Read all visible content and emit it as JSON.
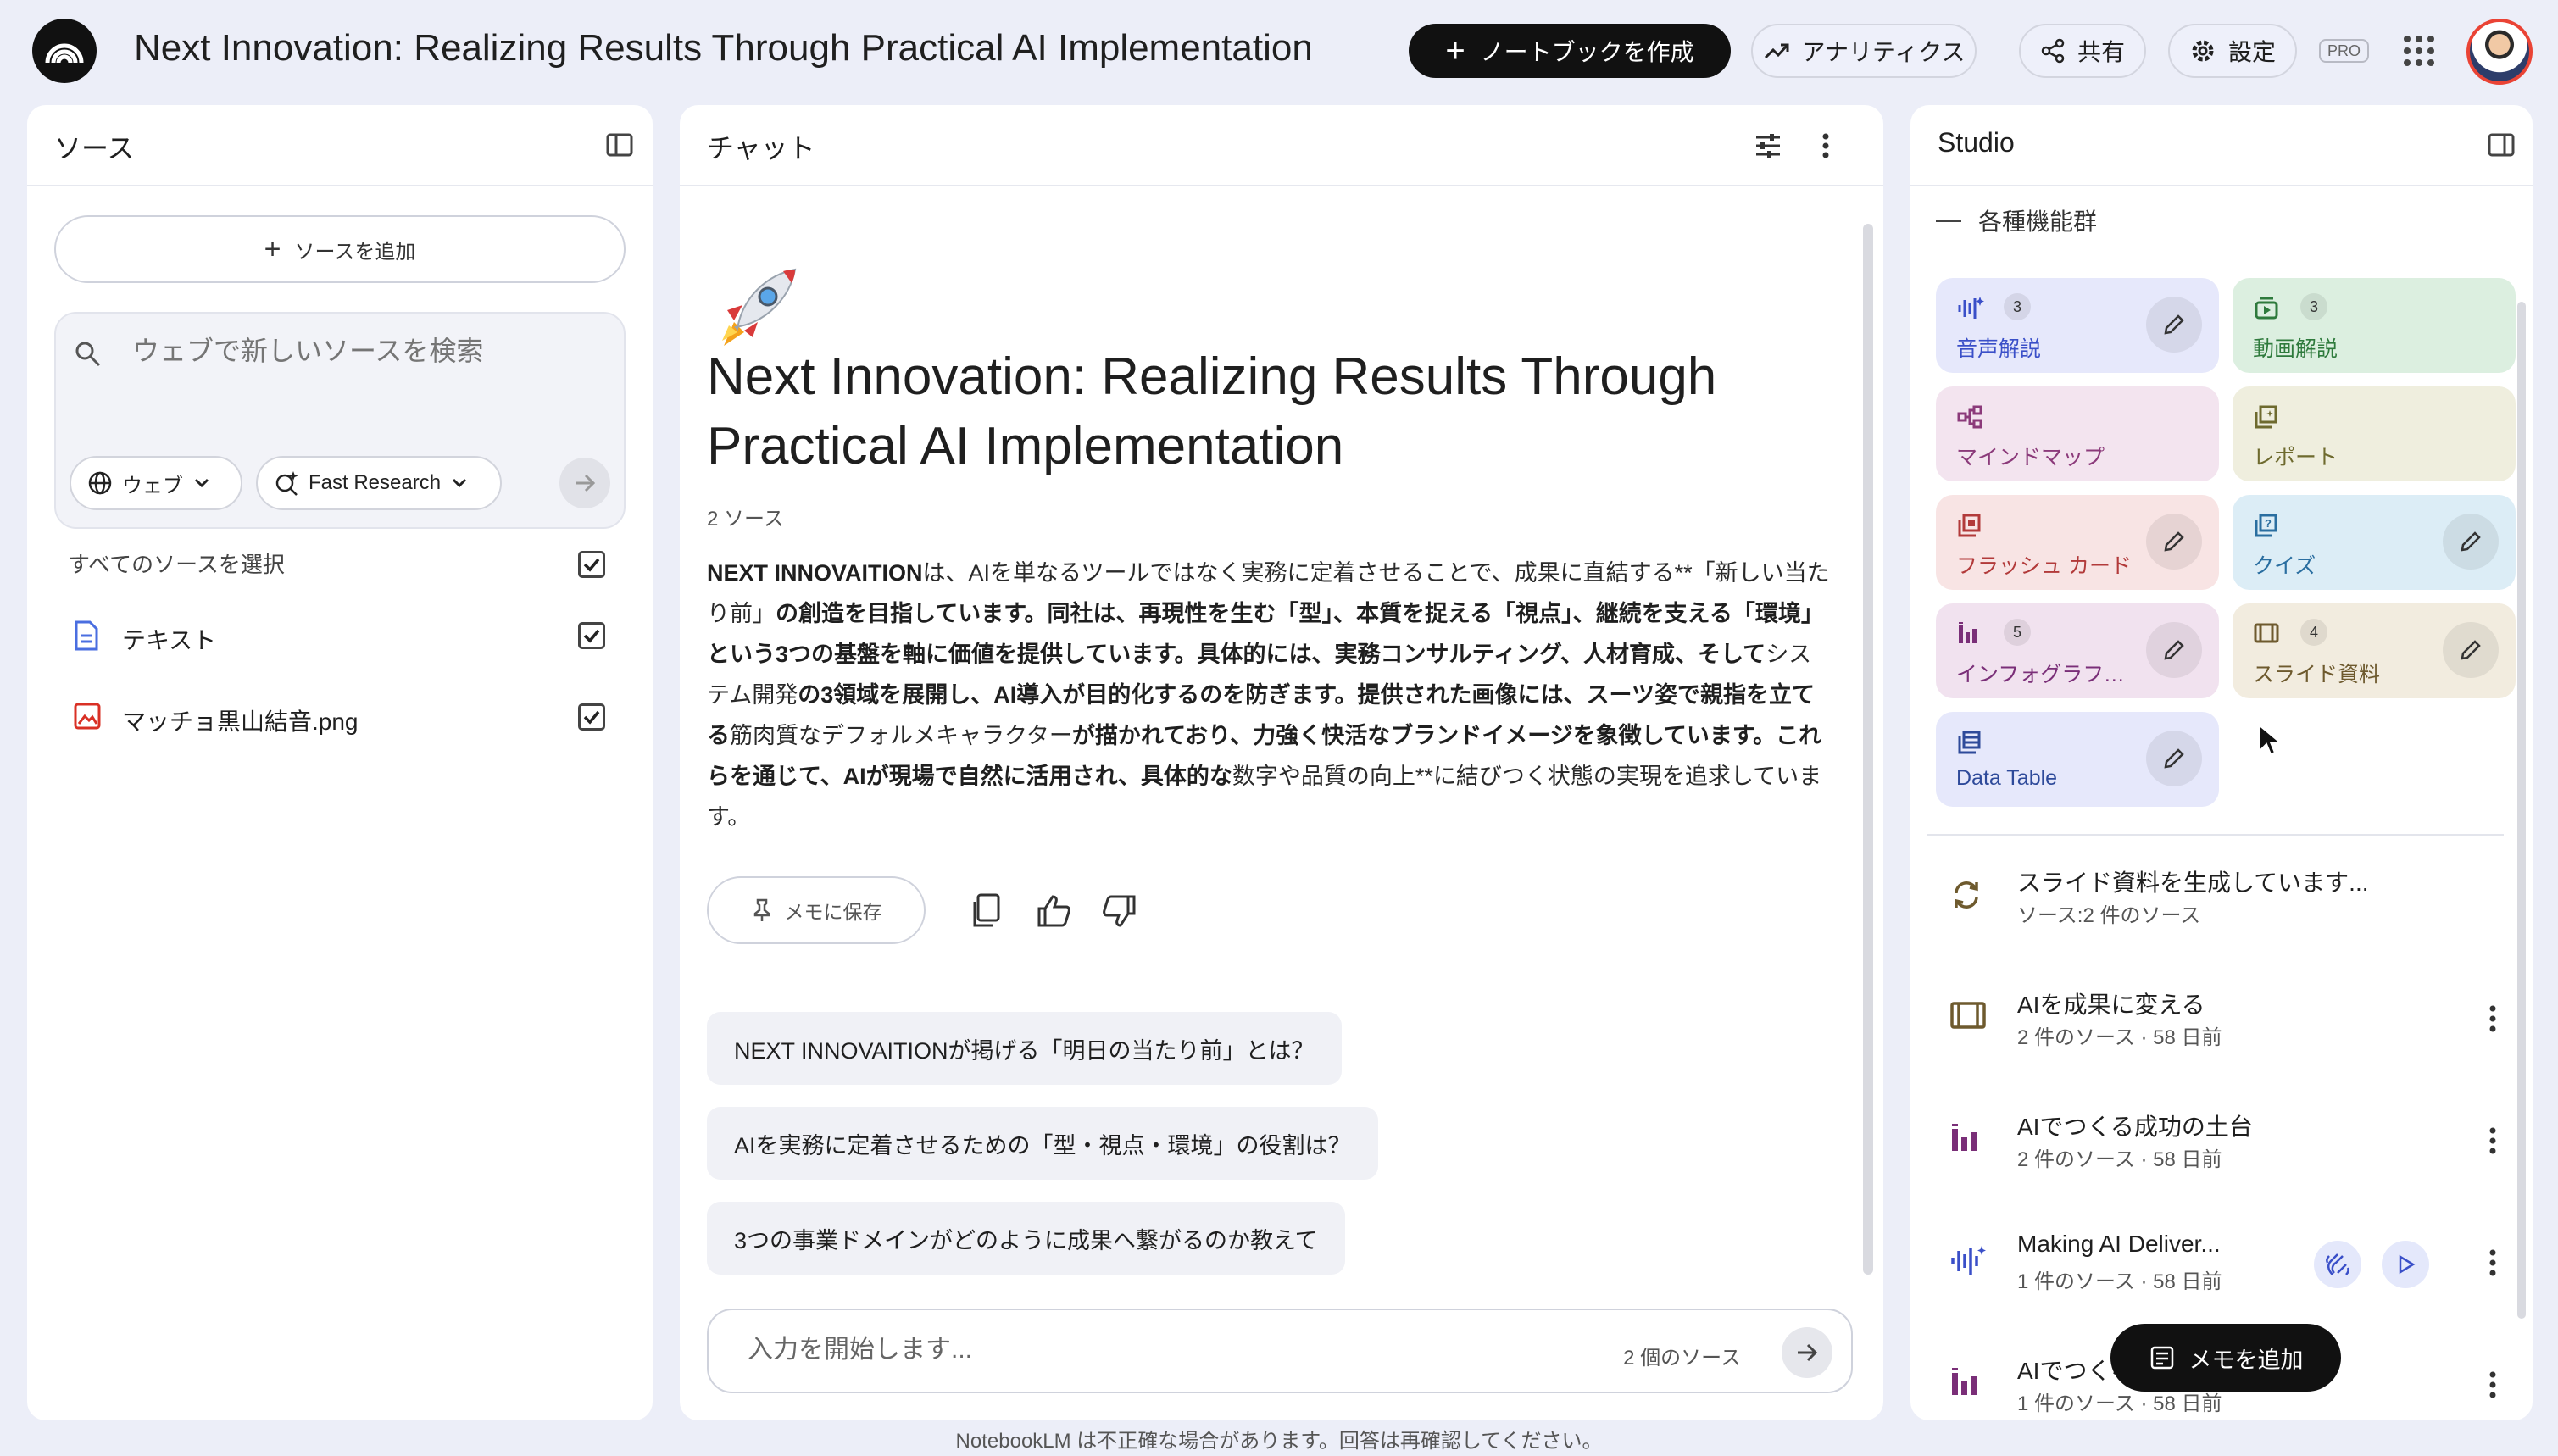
{
  "header": {
    "title": "Next Innovation: Realizing Results Through Practical AI Implementation",
    "create_label": "ノートブックを作成",
    "analytics_label": "アナリティクス",
    "share_label": "共有",
    "settings_label": "設定",
    "pro_badge": "PRO"
  },
  "sources": {
    "title": "ソース",
    "add_label": "ソースを追加",
    "search_placeholder": "ウェブで新しいソースを検索",
    "web_chip": "ウェブ",
    "research_chip": "Fast Research",
    "select_all": "すべてのソースを選択",
    "items": [
      {
        "name": "テキスト",
        "icon": "doc-icon",
        "checked": true
      },
      {
        "name": "マッチョ黒山結音.png",
        "icon": "image-icon",
        "checked": true
      }
    ]
  },
  "chat": {
    "title": "チャット",
    "heading": "Next Innovation: Realizing Results Through Practical AI Implementation",
    "source_count": "2 ソース",
    "save_memo": "メモに保存",
    "suggestions": [
      "NEXT INNOVAITIONが掲げる「明日の当たり前」とは？",
      "AIを実務に定着させるための「型・視点・環境」の役割は？",
      "3つの事業ドメインがどのように成果へ繋がるのか教えて"
    ],
    "input_placeholder": "入力を開始します...",
    "input_source_count": "2 個のソース"
  },
  "studio": {
    "title": "Studio",
    "group_label": "各種機能群",
    "tiles": [
      {
        "label": "音声解説",
        "count": "3",
        "icon": "audio-wave-icon"
      },
      {
        "label": "動画解説",
        "count": "3",
        "icon": "video-icon"
      },
      {
        "label": "マインドマップ",
        "count": "",
        "icon": "mindmap-icon"
      },
      {
        "label": "レポート",
        "count": "",
        "icon": "report-icon"
      },
      {
        "label": "フラッシュ カード",
        "count": "",
        "icon": "flashcard-icon"
      },
      {
        "label": "クイズ",
        "count": "",
        "icon": "quiz-icon"
      },
      {
        "label": "インフォグラフィ...",
        "count": "5",
        "icon": "infographic-icon"
      },
      {
        "label": "スライド資料",
        "count": "4",
        "icon": "slides-icon"
      },
      {
        "label": "Data Table",
        "count": "",
        "icon": "table-icon"
      }
    ],
    "notes": [
      {
        "title": "スライド資料を生成しています...",
        "sub": "ソース:2 件のソース",
        "icon": "sync-icon"
      },
      {
        "title": "AIを成果に変える",
        "sub": "2 件のソース · 58 日前",
        "icon": "slides-icon"
      },
      {
        "title": "AIでつくる成功の土台",
        "sub": "2 件のソース · 58 日前",
        "icon": "infographic-icon"
      },
      {
        "title": "Making AI Deliver...",
        "sub": "1 件のソース · 58 日前",
        "icon": "audio-wave-icon"
      },
      {
        "title": "AIでつくる業務改革の新常識",
        "sub": "1 件のソース · 58 日前",
        "icon": "infographic-icon"
      }
    ],
    "add_memo": "メモを追加"
  },
  "footer": {
    "disclaimer": "NotebookLM は不正確な場合があります。回答は再確認してください。"
  },
  "colors": {
    "audio": "#e6e8fb",
    "video": "#dcefe0",
    "mindmap": "#f3e4ef",
    "report": "#efeede",
    "flashcard": "#f8e4e4",
    "quiz": "#dcedf6",
    "infographic": "#f1e2ef",
    "slides": "#f2ecdf",
    "table": "#e6e8fb"
  }
}
